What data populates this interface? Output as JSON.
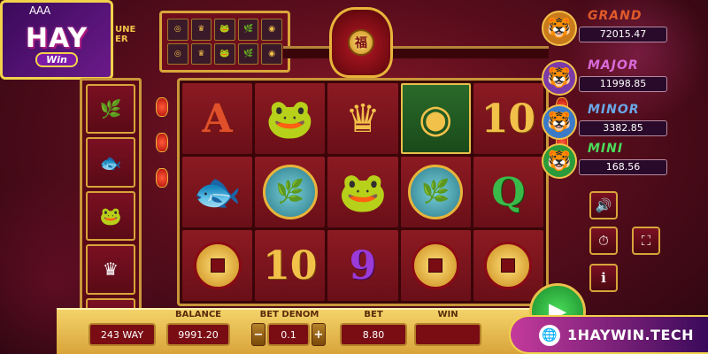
{
  "logo": {
    "brand_main": "HAY",
    "brand_sub": "Win",
    "cards_glyphs": "A A A"
  },
  "game_title_fragment": "UNE\nER",
  "jackpots": [
    {
      "name": "GRAND",
      "value": "72015.47",
      "color": "#e05a2a",
      "icon": "tiger-icon"
    },
    {
      "name": "MAJOR",
      "value": "11998.85",
      "color": "#d86ad8",
      "icon": "tiger-icon"
    },
    {
      "name": "MINOR",
      "value": "3382.85",
      "color": "#6aa8e8",
      "icon": "tiger-icon"
    },
    {
      "name": "MINI",
      "value": "168.56",
      "color": "#4adc5a",
      "icon": "tiger-icon"
    }
  ],
  "reels": [
    [
      {
        "kind": "letter",
        "text": "A",
        "style": "red"
      },
      {
        "kind": "fish",
        "glyph": "🐟"
      },
      {
        "kind": "coin"
      }
    ],
    [
      {
        "kind": "toad",
        "glyph": "🐸"
      },
      {
        "kind": "disc",
        "glyph": "🌿"
      },
      {
        "kind": "letter",
        "text": "10",
        "style": "gold"
      }
    ],
    [
      {
        "kind": "ingot",
        "glyph": "♛"
      },
      {
        "kind": "toad",
        "glyph": "🐸"
      },
      {
        "kind": "letter",
        "text": "9",
        "style": "purple"
      }
    ],
    [
      {
        "kind": "gong",
        "glyph": "◉",
        "highlight": true
      },
      {
        "kind": "disc",
        "glyph": "🌿"
      },
      {
        "kind": "coin"
      }
    ],
    [
      {
        "kind": "letter",
        "text": "10",
        "style": "gold"
      },
      {
        "kind": "letter",
        "text": "Q",
        "style": "green"
      },
      {
        "kind": "coin"
      }
    ]
  ],
  "left_strip": [
    "🌿",
    "🐟",
    "🐸",
    "♛",
    "◎"
  ],
  "preview_symbols": [
    "◎",
    "♛",
    "🐸",
    "🌿",
    "◉",
    "◎",
    "♛",
    "🐸",
    "🌿",
    "◉"
  ],
  "bottom": {
    "ways_value": "243 WAY",
    "balance_label": "BALANCE",
    "balance_value": "9991.20",
    "bet_denom_label": "BET DENOM",
    "bet_denom_value": "0.1",
    "bet_label": "BET",
    "bet_value": "8.80",
    "win_label": "WIN",
    "win_value": ""
  },
  "controls": {
    "sound_icon": "🔊",
    "history_icon": "⏱",
    "fullscreen_icon": "⛶",
    "info_icon": "i",
    "minus": "−",
    "plus": "+",
    "spin_icon": "▶",
    "urn_char": "福"
  },
  "watermark": {
    "url": "1HAYWIN.TECH",
    "globe_icon": "🌐"
  }
}
